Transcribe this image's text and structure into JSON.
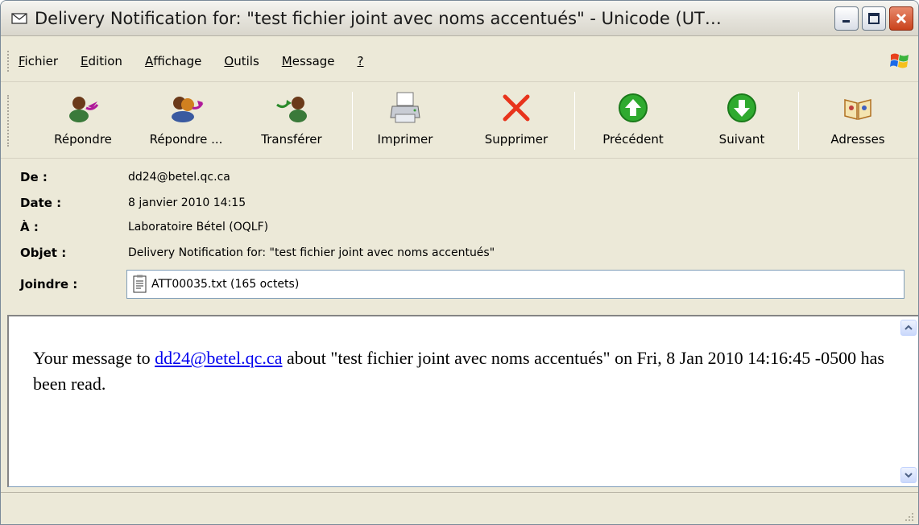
{
  "window": {
    "title": "Delivery Notification for: \"test fichier joint avec noms accentués\" - Unicode (UT…"
  },
  "menu": [
    {
      "pre": "",
      "key": "F",
      "post": "ichier"
    },
    {
      "pre": "",
      "key": "E",
      "post": "dition"
    },
    {
      "pre": "",
      "key": "A",
      "post": "ffichage"
    },
    {
      "pre": "",
      "key": "O",
      "post": "utils"
    },
    {
      "pre": "",
      "key": "M",
      "post": "essage"
    },
    {
      "pre": "",
      "key": "?",
      "post": ""
    }
  ],
  "toolbar": {
    "reply": "Répondre",
    "reply_all": "Répondre ...",
    "forward": "Transférer",
    "print": "Imprimer",
    "delete": "Supprimer",
    "previous": "Précédent",
    "next": "Suivant",
    "addresses": "Adresses"
  },
  "header": {
    "from_label": "De :",
    "from_value": "dd24@betel.qc.ca",
    "date_label": "Date :",
    "date_value": "8 janvier 2010 14:15",
    "to_label": "À :",
    "to_value": "Laboratoire Bétel (OQLF)",
    "subject_label": "Objet :",
    "subject_value": "Delivery Notification for: \"test fichier joint avec noms accentués\"",
    "attach_label": "Joindre :",
    "attach_value": "ATT00035.txt (165 octets)"
  },
  "body": {
    "text_before": "Your message to ",
    "link": "dd24@betel.qc.ca",
    "text_after": " about \"test fichier joint avec noms accentués\" on  Fri, 8 Jan 2010 14:16:45 -0500 has been read."
  },
  "colors": {
    "link": "#0000ee",
    "chrome": "#ece9d8",
    "delete_red": "#e8341c",
    "nav_green": "#2faa2f"
  }
}
